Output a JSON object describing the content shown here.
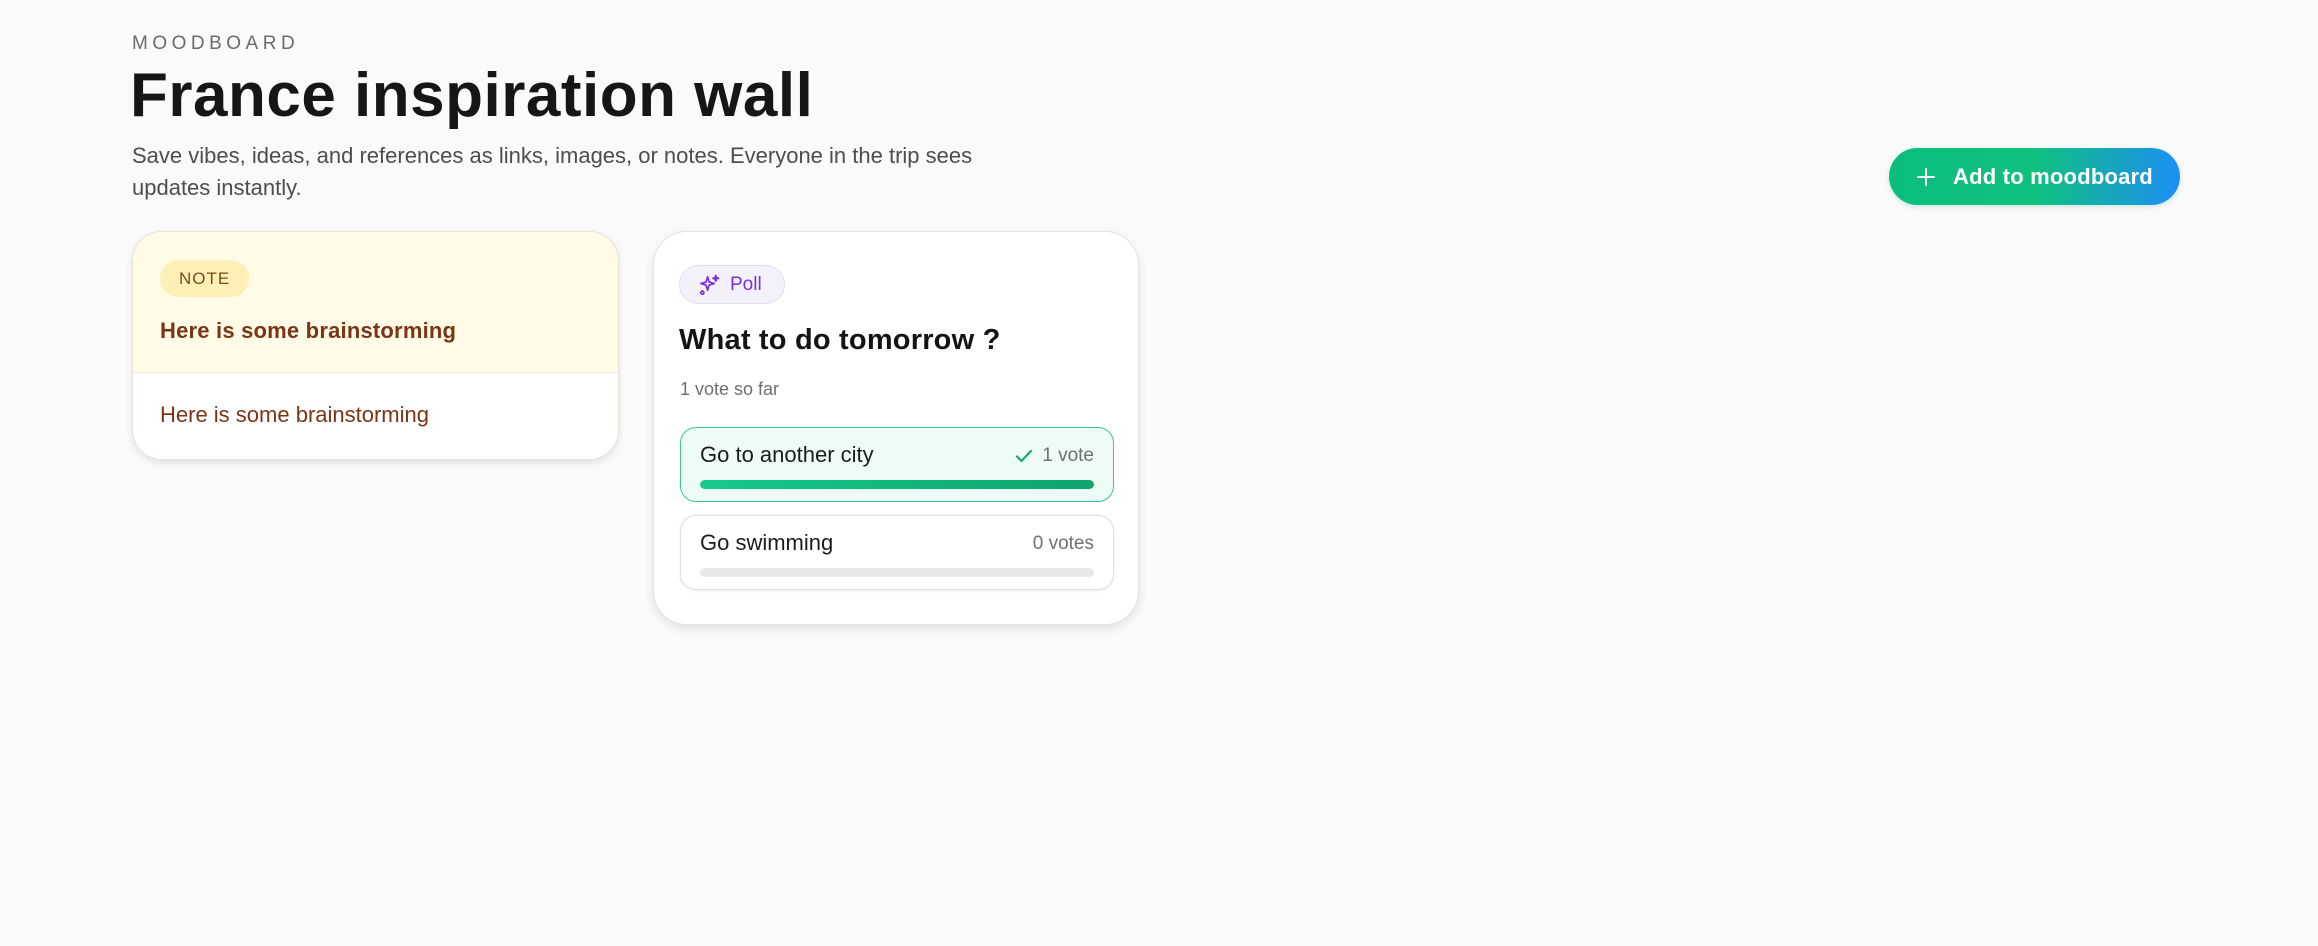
{
  "header": {
    "eyebrow": "MOODBOARD",
    "title": "France inspiration wall",
    "subtitle": "Save vibes, ideas, and references as links, images, or notes. Everyone in the trip sees updates instantly.",
    "add_button_label": "Add to moodboard",
    "add_button_icon": "plus-icon"
  },
  "note_card": {
    "badge": "NOTE",
    "title": "Here is some brainstorming",
    "body": "Here is some brainstorming"
  },
  "poll_card": {
    "badge_label": "Poll",
    "badge_icon": "sparkles-icon",
    "question": "What to do tomorrow ?",
    "vote_count_text": "1 vote so far",
    "options": [
      {
        "label": "Go to another city",
        "votes_text": "1 vote",
        "votes": 1,
        "share": 1.0,
        "selected": true
      },
      {
        "label": "Go swimming",
        "votes_text": "0 votes",
        "votes": 0,
        "share": 0.0,
        "selected": false
      }
    ]
  },
  "colors": {
    "page_background": "#fafafa",
    "accent_green": "#0fc07d",
    "accent_blue": "#1c8ff5",
    "note_background": "#fffbe7",
    "note_text": "#7a3514",
    "poll_accent": "#7a32d8"
  }
}
